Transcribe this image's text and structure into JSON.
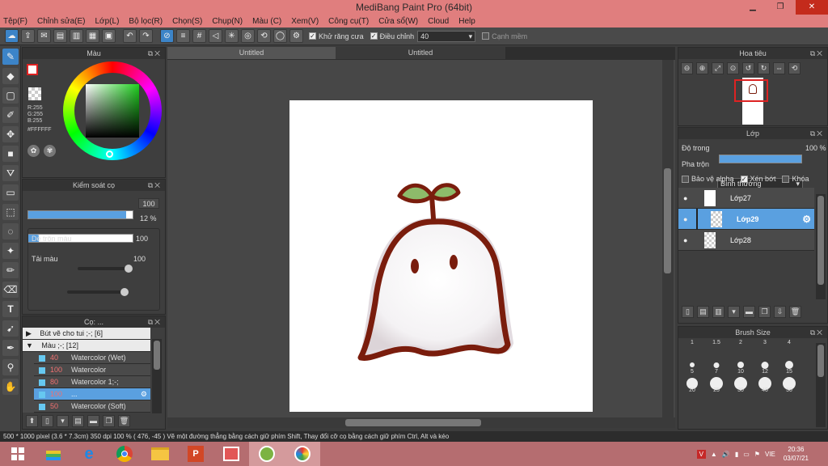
{
  "app": {
    "title": "MediBang Paint Pro (64bit)"
  },
  "menu": [
    "Tệp(F)",
    "Chỉnh sửa(E)",
    "Lớp(L)",
    "Bộ lọc(R)",
    "Chọn(S)",
    "Chụp(N)",
    "Màu (C)",
    "Xem(V)",
    "Công cụ(T)",
    "Cửa sổ(W)",
    "Cloud",
    "Help"
  ],
  "toolbar": {
    "antialias_label": "Khử răng cưa",
    "correction_label": "Điều chỉnh",
    "correction_value": "40",
    "snap_label": "Cạnh mềm"
  },
  "color_panel": {
    "title": "Màu",
    "r": "R:255",
    "g": "G:255",
    "b": "B:255",
    "hex": "#FFFFFF"
  },
  "brush_control": {
    "title": "Kiểm soát cọ",
    "size_value": "100",
    "opacity_value": "12 %",
    "size_fill": 0.94,
    "opacity_fill": 0.1,
    "blend_label": "Dễ trộn màu",
    "blend_value": "100",
    "amount_label": "Tải màu",
    "amount_value": "100",
    "blend_fill": 0.95,
    "amount_fill": 0.95
  },
  "brushes": {
    "title": "Cọ: ...",
    "groups": [
      "Bút vẽ cho tui ;-; [6]",
      "Màu ;-; [12]"
    ],
    "items": [
      {
        "size": "40",
        "name": "Watercolor (Wet)"
      },
      {
        "size": "100",
        "name": "Watercolor"
      },
      {
        "size": "80",
        "name": "Watercolor 1;-;"
      },
      {
        "size": "100",
        "name": "..."
      },
      {
        "size": "50",
        "name": "Watercolor (Soft)"
      }
    ]
  },
  "tabs": [
    "Untitled",
    "Untitled"
  ],
  "navigator": {
    "title": "Hoa tiêu"
  },
  "layers": {
    "title": "Lớp",
    "opacity_label": "Độ trong",
    "opacity_value": "100 %",
    "blend_label": "Pha trộn",
    "blend_value": "Bình thường",
    "protect_alpha": "Bảo vệ alpha",
    "clipping": "Xén bớt",
    "lock": "Khóa",
    "items": [
      "Lớp27",
      "Lớp29",
      "Lớp28"
    ]
  },
  "brush_size": {
    "title": "Brush Size",
    "labels": [
      "1",
      "1.5",
      "2",
      "3",
      "4",
      "5",
      "7",
      "10",
      "12",
      "15",
      "20",
      "25",
      "30",
      "40",
      "50"
    ]
  },
  "status": "500 * 1000 pixel   (3.6 * 7.3cm)   350 dpi   100 %   ( 476, -45 )   Vẽ một đường thẳng bằng cách giữ phím Shift, Thay đổi cỡ cọ bằng cách giữ phím Ctrl, Alt và kéo",
  "taskbar": {
    "lang": "VIE",
    "time": "20:36",
    "date": "03/07/21"
  }
}
